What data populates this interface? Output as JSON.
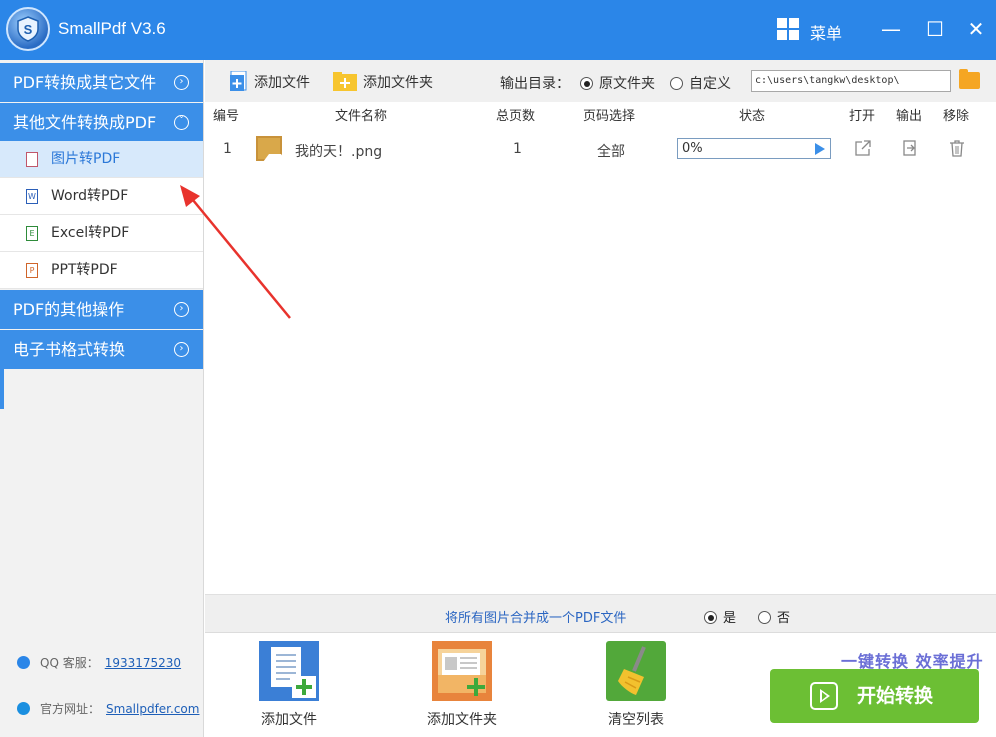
{
  "app": {
    "title": "SmallPdf V3.6",
    "menu_label": "菜单",
    "minimize": "—",
    "maximize": "☐",
    "close": "✕"
  },
  "sidebar": {
    "groups": [
      {
        "label": "PDF转换成其它文件"
      },
      {
        "label": "其他文件转换成PDF"
      },
      {
        "label": "PDF的其他操作"
      },
      {
        "label": "电子书格式转换"
      }
    ],
    "items": [
      {
        "label": "图片转PDF",
        "icon_letter": ""
      },
      {
        "label": "Word转PDF",
        "icon_letter": "W"
      },
      {
        "label": "Excel转PDF",
        "icon_letter": "E"
      },
      {
        "label": "PPT转PDF",
        "icon_letter": "P"
      }
    ],
    "qq_label": "QQ 客服：",
    "qq_value": "1933175230",
    "site_label": "官方网址：",
    "site_value": "Smallpdfer.com"
  },
  "toolbar": {
    "add_file": "添加文件",
    "add_folder": "添加文件夹",
    "output_label": "输出目录：",
    "option_original": "原文件夹",
    "option_custom": "自定义",
    "path": "c:\\users\\tangkw\\desktop\\"
  },
  "table": {
    "headers": [
      "编号",
      "文件名称",
      "总页数",
      "页码选择",
      "状态",
      "打开",
      "输出",
      "移除"
    ],
    "rows": [
      {
        "index": "1",
        "filename": "我的天！.png",
        "pages": "1",
        "page_select": "全部",
        "status": "0%"
      }
    ]
  },
  "merge": {
    "text": "将所有图片合并成一个PDF文件",
    "yes": "是",
    "no": "否"
  },
  "bottom": {
    "add_file": "添加文件",
    "add_folder": "添加文件夹",
    "clear_list": "清空列表",
    "slogan": "一键转换  效率提升",
    "start": "开始转换"
  },
  "colors": {
    "titlebar": "#2b86e8",
    "group": "#3b8fe8",
    "start": "#6cbf34",
    "arrow": "#e8332d"
  }
}
